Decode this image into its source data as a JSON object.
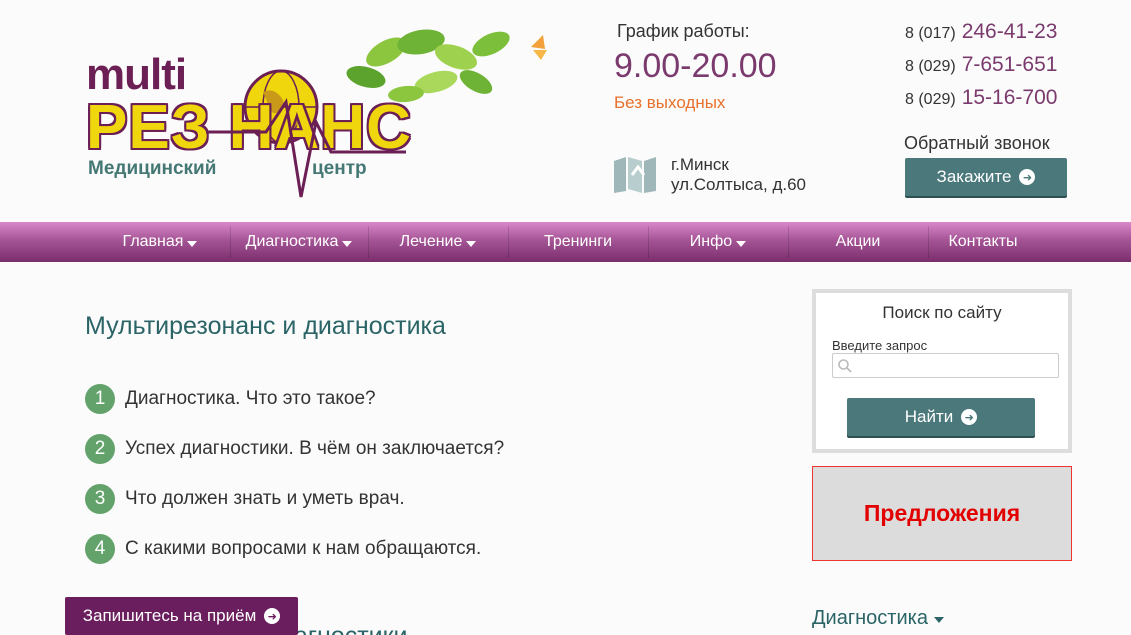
{
  "logo": {
    "multi": "multi",
    "res": "РЕЗ   НАНС",
    "subtitle_left": "Медицинский",
    "subtitle_right": "центр"
  },
  "schedule": {
    "title": "График работы:",
    "hours": "9.00-20.00",
    "note": "Без выходных"
  },
  "address": {
    "city": "г.Минск",
    "street": "ул.Солтыса, д.60"
  },
  "phones": [
    {
      "code": "8 (017)",
      "number": "246-41-23"
    },
    {
      "code": "8 (029)",
      "number": "7-651-651"
    },
    {
      "code": "8 (029)",
      "number": "15-16-700"
    }
  ],
  "callback": {
    "label": "Обратный звонок",
    "button": "Закажите"
  },
  "nav": {
    "items": [
      {
        "label": "Главная",
        "dropdown": true
      },
      {
        "label": "Диагностика",
        "dropdown": true
      },
      {
        "label": "Лечение",
        "dropdown": true
      },
      {
        "label": "Тренинги",
        "dropdown": false
      },
      {
        "label": "Инфо",
        "dropdown": true
      },
      {
        "label": "Акции",
        "dropdown": false
      },
      {
        "label": "Контакты",
        "dropdown": false
      }
    ]
  },
  "main": {
    "title": "Мультирезонанс и диагностика",
    "list": [
      {
        "num": "1",
        "text": "Диагностика. Что это такое?"
      },
      {
        "num": "2",
        "text": "Успех диагностики. В чём он заключается?"
      },
      {
        "num": "3",
        "text": "Что должен знать и уметь врач."
      },
      {
        "num": "4",
        "text": "С какими вопросами к нам обращаются."
      }
    ],
    "next_heading": "иагностики"
  },
  "appointment_button": "Запишитесь на приём",
  "search": {
    "title": "Поиск по сайту",
    "label": "Введите запрос",
    "placeholder": "",
    "button": "Найти"
  },
  "offers": {
    "label": "Предложения"
  },
  "sidebar_menu": {
    "item": "Диагностика"
  },
  "colors": {
    "accent_teal": "#4a787b",
    "brand_purple": "#7b3a6e",
    "badge_green": "#63a26b",
    "offers_red": "#e30000"
  }
}
